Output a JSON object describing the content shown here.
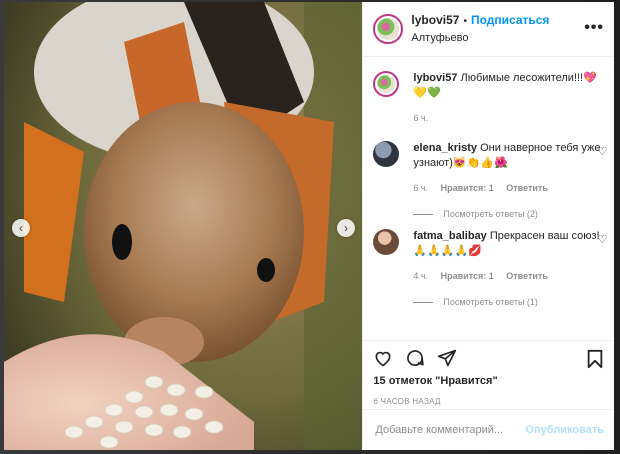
{
  "post": {
    "username": "lybovi57",
    "follow_label": "Подписаться",
    "location": "Алтуфьево",
    "more_label": "•••"
  },
  "caption": {
    "username": "lybovi57",
    "text": "Любимые лесожители!!!💖💛💚",
    "time": "6 ч."
  },
  "comments": [
    {
      "username": "elena_kristy",
      "text": "Они наверное тебя уже узнают)😻👏👍🌺",
      "time": "6 ч.",
      "likes": "Нравится: 1",
      "reply": "Ответить",
      "view_replies": "Посмотреть ответы (2)"
    },
    {
      "username": "fatma_balibay",
      "text": "Прекрасен ваш союз! 🙏🙏🙏🙏💋",
      "time": "4 ч.",
      "likes": "Нравится: 1",
      "reply": "Ответить",
      "view_replies": "Посмотреть ответы (1)"
    }
  ],
  "footer": {
    "likes": "15 отметок \"Нравится\"",
    "timestamp": "6 ЧАСОВ НАЗАД",
    "comment_placeholder": "Добавьте комментарий...",
    "publish_label": "Опубликовать"
  },
  "icons": {
    "heart": "heart-icon",
    "comment": "comment-icon",
    "share": "paper-plane-icon",
    "bookmark": "bookmark-icon"
  }
}
